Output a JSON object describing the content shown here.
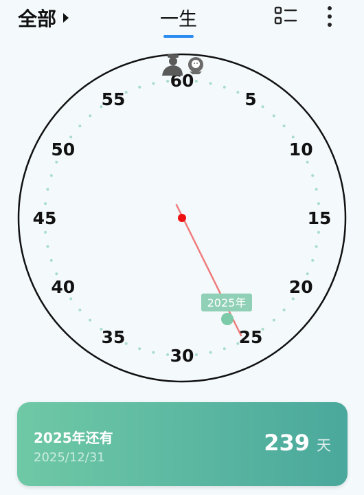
{
  "header": {
    "filter_label": "全部",
    "tab_label": "一生",
    "accent_color": "#2d8cf0",
    "icons": [
      "caret-right-icon",
      "list-view-icon",
      "more-vertical-icon"
    ]
  },
  "clock": {
    "labels": [
      "60",
      "5",
      "10",
      "15",
      "20",
      "25",
      "30",
      "35",
      "40",
      "45",
      "50",
      "55"
    ],
    "current_year_label": "2025年",
    "marker_color": "#7dcaa8",
    "hand_color": "#f07b7b",
    "center_color": "#ee1111",
    "top_icons": [
      "person-icon",
      "baby-icon"
    ]
  },
  "card": {
    "title": "2025年还有",
    "date": "2025/12/31",
    "days": "239",
    "unit": "天"
  }
}
